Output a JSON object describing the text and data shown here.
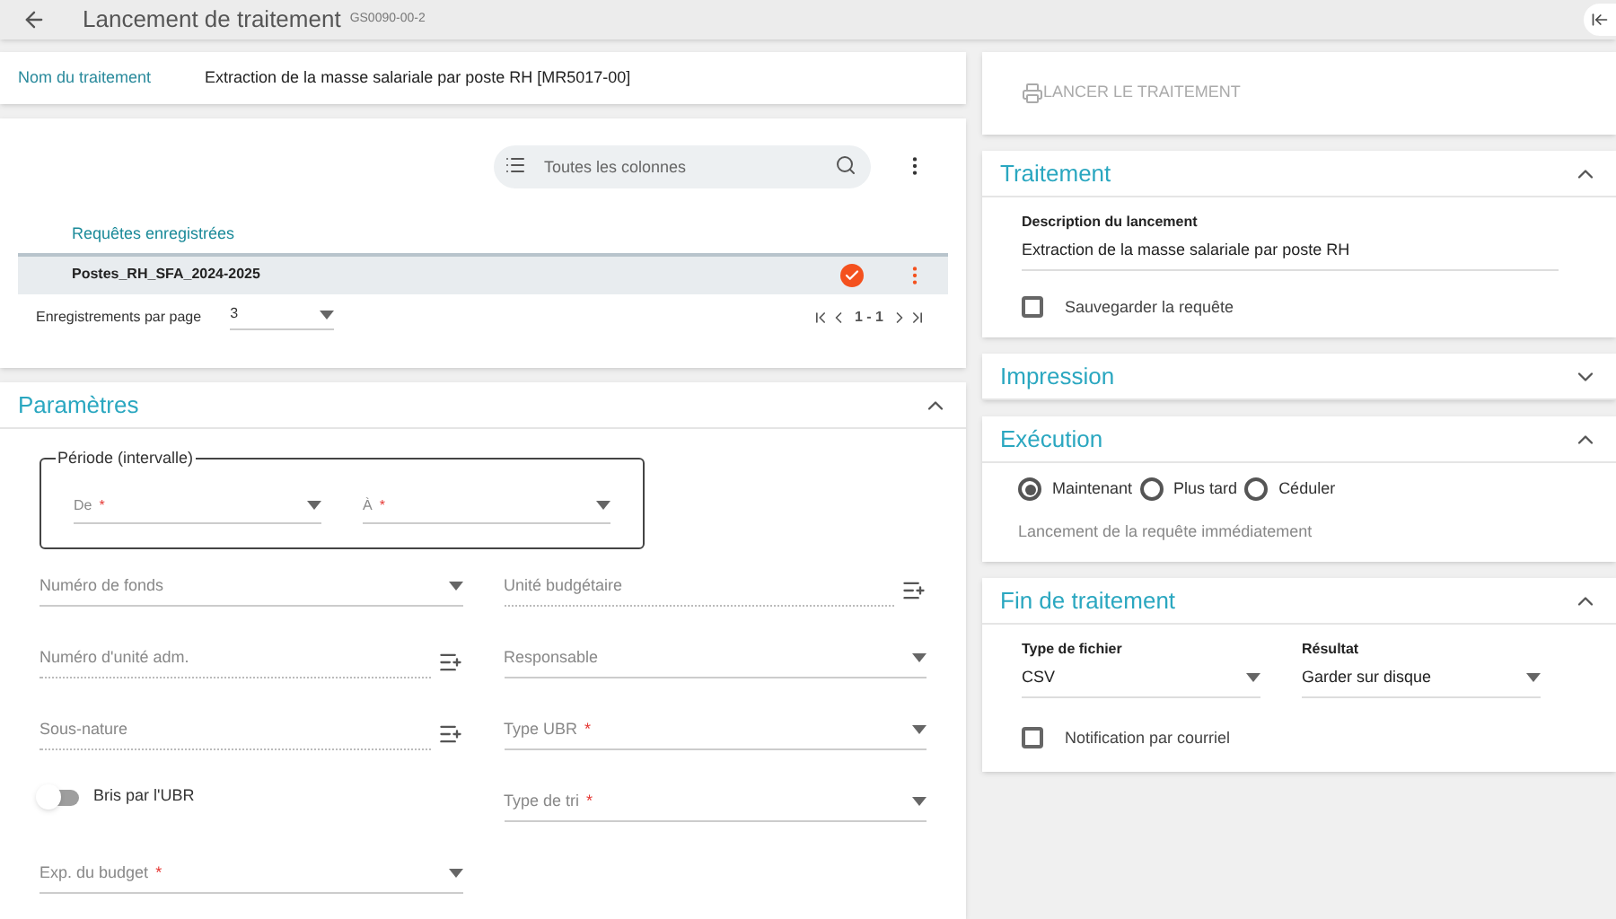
{
  "header": {
    "title": "Lancement de traitement",
    "code": "GS0090-00-2"
  },
  "treatment_name": {
    "label": "Nom du traitement",
    "value": "Extraction de la masse salariale par poste RH [MR5017-00]"
  },
  "saved_queries": {
    "search": {
      "placeholder": "Toutes les colonnes"
    },
    "column": "Requêtes enregistrées",
    "rows": [
      {
        "name": "Postes_RH_SFA_2024-2025",
        "selected": true
      }
    ],
    "pager": {
      "label": "Enregistrements par page",
      "per_page": "3",
      "range": "1 - 1"
    }
  },
  "parameters": {
    "title": "Paramètres",
    "expanded": true,
    "period": {
      "legend": "Période (intervalle)",
      "fields": [
        {
          "label": "De",
          "required_mark": "*"
        },
        {
          "label": "À",
          "required_mark": "*"
        }
      ]
    },
    "left": [
      {
        "kind": "dropdown",
        "label": "Numéro de fonds"
      },
      {
        "kind": "picker",
        "label": "Numéro d'unité adm."
      },
      {
        "kind": "picker",
        "label": "Sous-nature"
      },
      {
        "kind": "toggle",
        "label": "Bris par l'UBR",
        "on": false
      },
      {
        "kind": "dropdown",
        "label": "Exp. du budget",
        "required_mark": "*"
      }
    ],
    "right": [
      {
        "kind": "picker",
        "label": "Unité budgétaire"
      },
      {
        "kind": "dropdown",
        "label": "Responsable"
      },
      {
        "kind": "dropdown",
        "label": "Type UBR",
        "required_mark": "*"
      },
      {
        "kind": "dropdown",
        "label": "Type de tri",
        "required_mark": "*"
      }
    ]
  },
  "launch_button": {
    "label": "LANCER LE TRAITEMENT",
    "disabled": true
  },
  "treatment": {
    "title": "Traitement",
    "expanded": true,
    "description_label": "Description du lancement",
    "description": "Extraction de la masse salariale par poste RH",
    "save_query": {
      "label": "Sauvegarder la requête",
      "checked": false
    }
  },
  "printing": {
    "title": "Impression",
    "expanded": false
  },
  "execution": {
    "title": "Exécution",
    "expanded": true,
    "options": [
      {
        "label": "Maintenant",
        "selected": true
      },
      {
        "label": "Plus tard",
        "selected": false
      },
      {
        "label": "Céduler",
        "selected": false
      }
    ],
    "hint": "Lancement de la requête immédiatement"
  },
  "end": {
    "title": "Fin de traitement",
    "expanded": true,
    "selects": [
      {
        "label": "Type de fichier",
        "value": "CSV"
      },
      {
        "label": "Résultat",
        "value": "Garder sur disque"
      }
    ],
    "notify": {
      "label": "Notification par courriel",
      "checked": false
    }
  }
}
